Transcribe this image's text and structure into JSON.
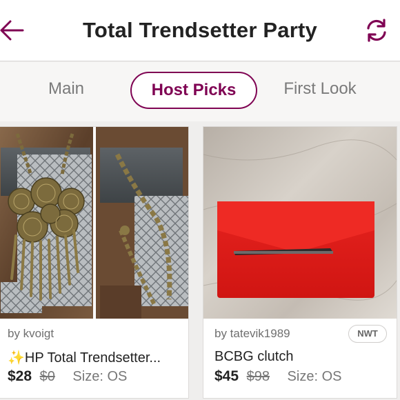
{
  "header": {
    "title": "Total Trendsetter Party",
    "back_icon": "arrow-left-icon",
    "refresh_icon": "refresh-icon",
    "accent_color": "#7f0353"
  },
  "tabs": [
    {
      "label": "Main",
      "active": false
    },
    {
      "label": "Host Picks",
      "active": true
    },
    {
      "label": "First Look",
      "active": false
    }
  ],
  "listings": [
    {
      "seller": "by kvoigt",
      "title_prefix": "✨",
      "title": "HP Total Trendsetter...",
      "price": "$28",
      "original_price": "$0",
      "size": "Size: OS",
      "badge": ""
    },
    {
      "seller": "by tatevik1989",
      "title_prefix": "",
      "title": "BCBG clutch",
      "price": "$45",
      "original_price": "$98",
      "size": "Size: OS",
      "badge": "NWT"
    }
  ]
}
